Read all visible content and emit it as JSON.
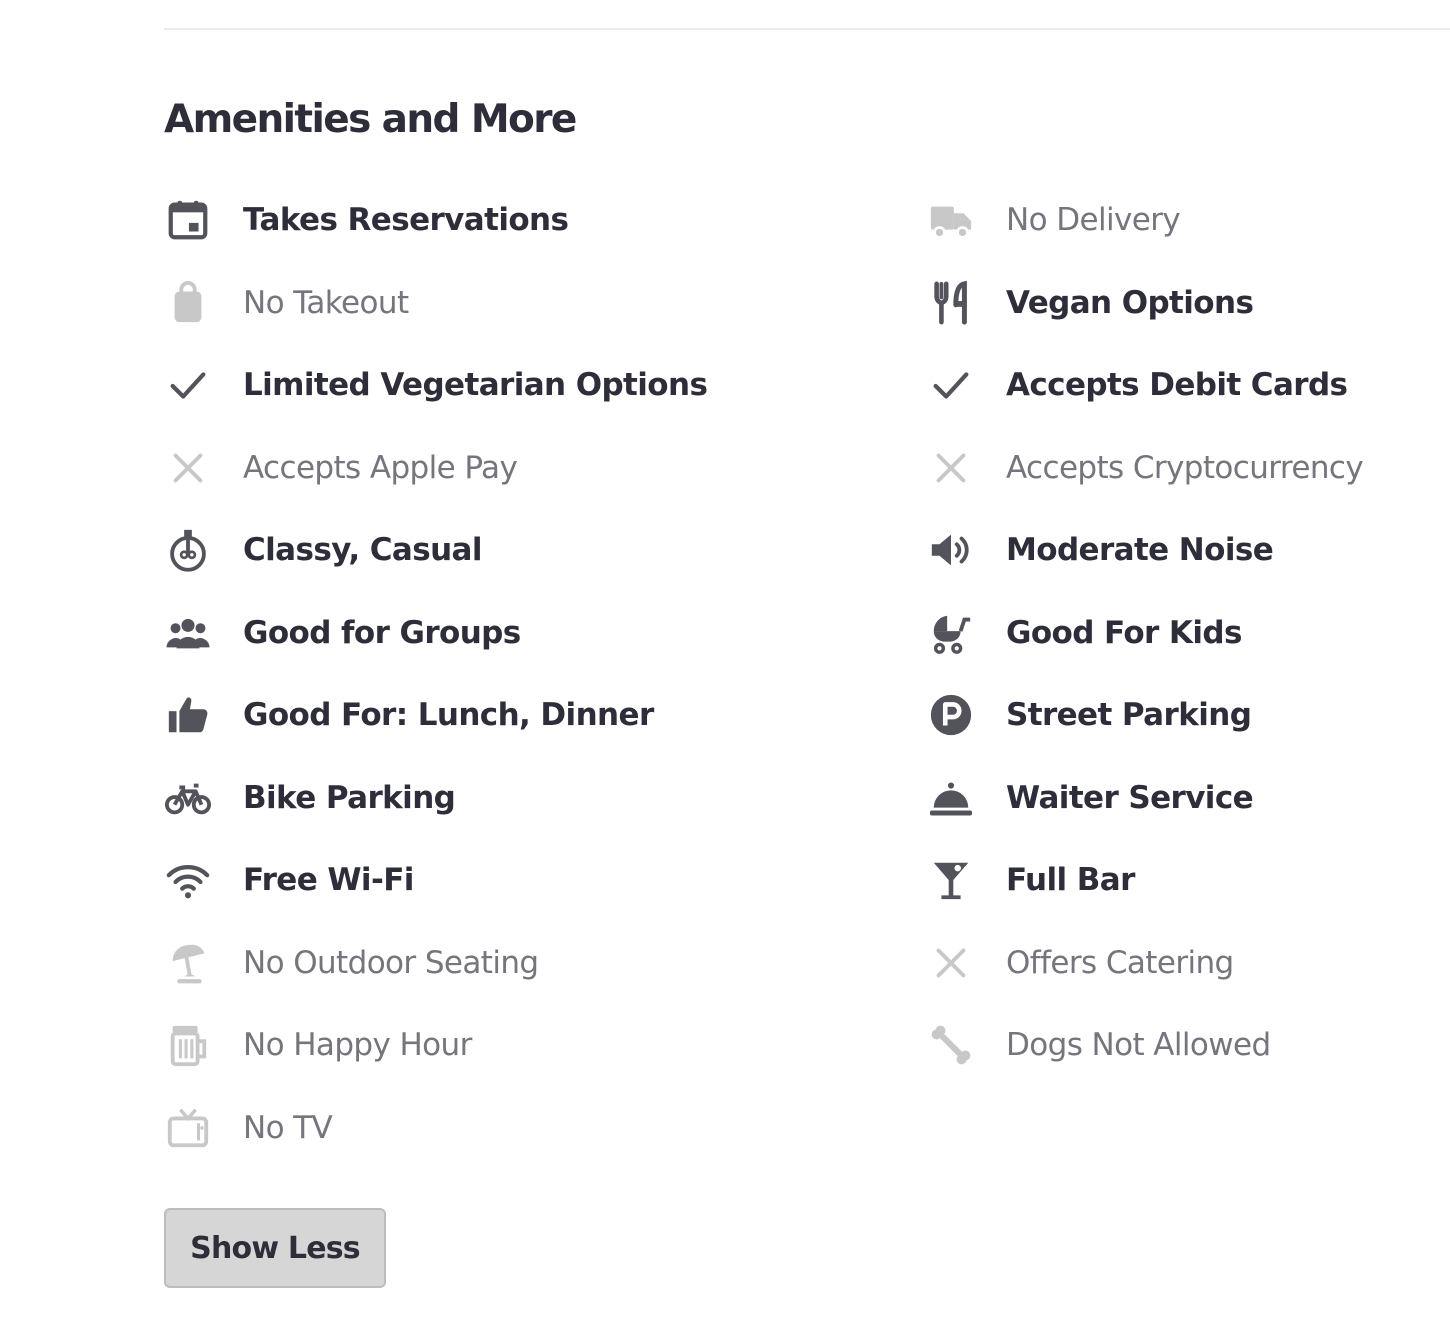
{
  "section": {
    "title": "Amenities and More",
    "show_less_label": "Show Less"
  },
  "colors": {
    "available_icon": "#52535b",
    "unavailable_icon": "#c8c8c8",
    "available_text": "#2d2e3a",
    "unavailable_text": "#74757d",
    "button_bg": "#d6d6d6"
  },
  "amenities": {
    "left": [
      {
        "label": "Takes Reservations",
        "icon": "calendar-icon",
        "available": true
      },
      {
        "label": "No Takeout",
        "icon": "shopping-bag-icon",
        "available": false
      },
      {
        "label": "Limited Vegetarian Options",
        "icon": "checkmark-icon",
        "available": true
      },
      {
        "label": "Accepts Apple Pay",
        "icon": "close-icon",
        "available": false
      },
      {
        "label": "Classy, Casual",
        "icon": "bell-icon",
        "available": true
      },
      {
        "label": "Good for Groups",
        "icon": "group-icon",
        "available": true
      },
      {
        "label": "Good For: Lunch, Dinner",
        "icon": "thumbs-up-icon",
        "available": true
      },
      {
        "label": "Bike Parking",
        "icon": "bicycle-icon",
        "available": true
      },
      {
        "label": "Free Wi-Fi",
        "icon": "wifi-icon",
        "available": true
      },
      {
        "label": "No Outdoor Seating",
        "icon": "umbrella-icon",
        "available": false
      },
      {
        "label": "No Happy Hour",
        "icon": "beer-mug-icon",
        "available": false
      },
      {
        "label": "No TV",
        "icon": "tv-icon",
        "available": false
      }
    ],
    "right": [
      {
        "label": "No Delivery",
        "icon": "delivery-truck-icon",
        "available": false
      },
      {
        "label": "Vegan Options",
        "icon": "fork-knife-icon",
        "available": true
      },
      {
        "label": "Accepts Debit Cards",
        "icon": "checkmark-icon",
        "available": true
      },
      {
        "label": "Accepts Cryptocurrency",
        "icon": "close-icon",
        "available": false
      },
      {
        "label": "Moderate Noise",
        "icon": "speaker-icon",
        "available": true
      },
      {
        "label": "Good For Kids",
        "icon": "stroller-icon",
        "available": true
      },
      {
        "label": "Street Parking",
        "icon": "parking-icon",
        "available": true
      },
      {
        "label": "Waiter Service",
        "icon": "cloche-icon",
        "available": true
      },
      {
        "label": "Full Bar",
        "icon": "cocktail-icon",
        "available": true
      },
      {
        "label": "Offers Catering",
        "icon": "close-icon",
        "available": false
      },
      {
        "label": "Dogs Not Allowed",
        "icon": "dog-bone-icon",
        "available": false
      }
    ]
  }
}
